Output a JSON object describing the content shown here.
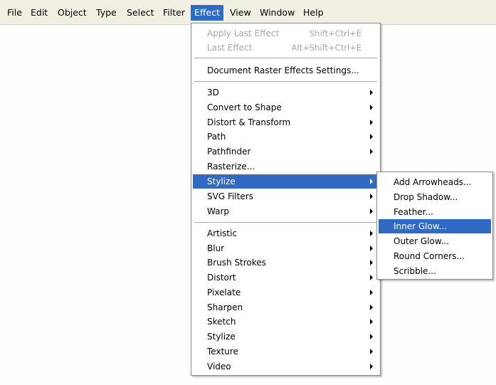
{
  "menubar": {
    "items": [
      "File",
      "Edit",
      "Object",
      "Type",
      "Select",
      "Filter",
      "Effect",
      "View",
      "Window",
      "Help"
    ],
    "active": "Effect"
  },
  "effect_menu": {
    "apply_last_effect": {
      "label": "Apply Last Effect",
      "shortcut": "Shift+Ctrl+E",
      "enabled": false
    },
    "last_effect": {
      "label": "Last Effect",
      "shortcut": "Alt+Shift+Ctrl+E",
      "enabled": false
    },
    "document_raster": {
      "label": "Document Raster Effects Settings..."
    },
    "illustrator_effects": [
      {
        "label": "3D",
        "submenu": true
      },
      {
        "label": "Convert to Shape",
        "submenu": true
      },
      {
        "label": "Distort & Transform",
        "submenu": true
      },
      {
        "label": "Path",
        "submenu": true
      },
      {
        "label": "Pathfinder",
        "submenu": true
      },
      {
        "label": "Rasterize...",
        "submenu": false
      },
      {
        "label": "Stylize",
        "submenu": true,
        "highlighted": true
      },
      {
        "label": "SVG Filters",
        "submenu": true
      },
      {
        "label": "Warp",
        "submenu": true
      }
    ],
    "photoshop_effects": [
      {
        "label": "Artistic",
        "submenu": true
      },
      {
        "label": "Blur",
        "submenu": true
      },
      {
        "label": "Brush Strokes",
        "submenu": true
      },
      {
        "label": "Distort",
        "submenu": true
      },
      {
        "label": "Pixelate",
        "submenu": true
      },
      {
        "label": "Sharpen",
        "submenu": true
      },
      {
        "label": "Sketch",
        "submenu": true
      },
      {
        "label": "Stylize",
        "submenu": true
      },
      {
        "label": "Texture",
        "submenu": true
      },
      {
        "label": "Video",
        "submenu": true
      }
    ]
  },
  "stylize_submenu": {
    "items": [
      {
        "label": "Add Arrowheads..."
      },
      {
        "label": "Drop Shadow..."
      },
      {
        "label": "Feather..."
      },
      {
        "label": "Inner Glow...",
        "highlighted": true
      },
      {
        "label": "Outer Glow..."
      },
      {
        "label": "Round Corners..."
      },
      {
        "label": "Scribble..."
      }
    ]
  },
  "colors": {
    "highlight": "#316ac5",
    "menubar_bg": "#f1efe2",
    "disabled_text": "#a8a8a8"
  }
}
